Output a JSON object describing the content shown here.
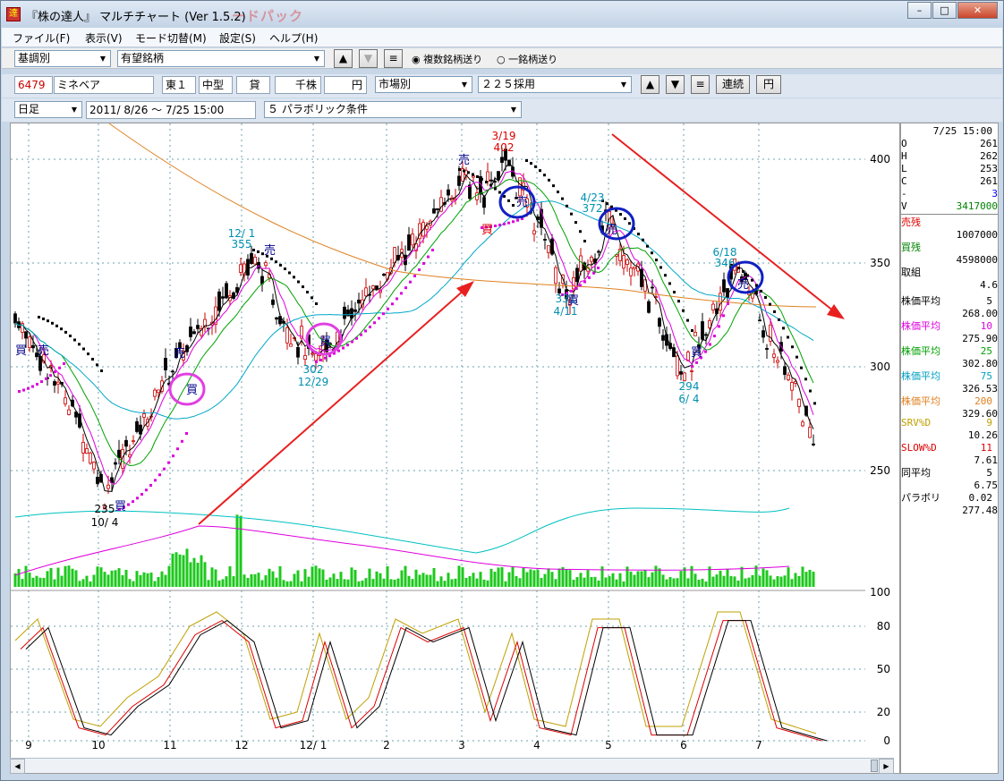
{
  "window": {
    "title": "『株の達人』 マルチチャート (Ver 1.5.2)",
    "watermark": "ードパック",
    "min": "–",
    "max": "□",
    "close": "✕"
  },
  "menu": [
    "ファイル(F)",
    "表示(V)",
    "モード切替(M)",
    "設定(S)",
    "ヘルプ(H)"
  ],
  "toolbar1": {
    "category": "基調別",
    "list": "有望銘柄",
    "up": "▲",
    "down": "▼",
    "eq": "≡",
    "radio1": "複数銘柄送り",
    "radio2": "一銘柄送り"
  },
  "toolbar2": {
    "code": "6479",
    "name": "ミネベア",
    "market": "東１",
    "size": "中型",
    "lend": "貸",
    "unit": "千株",
    "yen_box": "",
    "yen": "円",
    "group": "市場別",
    "index": "２２５採用",
    "up": "▲",
    "down": "▼",
    "eq": "≡",
    "cont": "連続",
    "yen2": "円"
  },
  "toolbar3": {
    "period": "日足",
    "range": "2011/ 8/26 ～  7/25 15:00",
    "condition": "５ パラボリック条件"
  },
  "info": {
    "date": "7/25 15:00",
    "O": "261",
    "H": "262",
    "L": "253",
    "C": "261",
    "chg_label": "-",
    "chg": "3",
    "V": "3417000",
    "sell_label": "売残",
    "sell": "1007000",
    "buy_label": "買残",
    "buy": "4598000",
    "ratio_label": "取組",
    "ratio": "4.6",
    "ma": [
      {
        "label": "株価平均",
        "n": "5",
        "v": "268.00",
        "color": "#000000"
      },
      {
        "label": "株価平均",
        "n": "10",
        "v": "275.90",
        "color": "#dd00dd"
      },
      {
        "label": "株価平均",
        "n": "25",
        "v": "302.80",
        "color": "#00a000"
      },
      {
        "label": "株価平均",
        "n": "75",
        "v": "326.53",
        "color": "#00a0c0"
      },
      {
        "label": "株価平均",
        "n": "200",
        "v": "329.60",
        "color": "#e08020"
      }
    ],
    "srvd_label": "SRV%D",
    "srvd_n": "9",
    "srvd": "10.26",
    "slowd_label": "SLOW%D",
    "slowd_n": "11",
    "slowd": "7.61",
    "avg_label": "同平均",
    "avg_n": "5",
    "avg": "6.75",
    "para_label": "パラボリ",
    "para_n": "0.02",
    "para": "277.48"
  },
  "chart_data": {
    "type": "candlestick",
    "price_ticks": [
      "400",
      "350",
      "300",
      "250"
    ],
    "osc_ticks": [
      "100",
      "80",
      "50",
      "20",
      "0"
    ],
    "months": [
      "9",
      "10",
      "11",
      "12",
      "12/ 1",
      "2",
      "3",
      "4",
      "5",
      "6",
      "7"
    ],
    "annotations": [
      {
        "t": "3/19",
        "c": "#d00"
      },
      {
        "t": "402",
        "c": "#d00"
      },
      {
        "t": "12/ 1",
        "c": "#0090b0"
      },
      {
        "t": "355",
        "c": "#0090b0"
      },
      {
        "t": "4/23",
        "c": "#0090b0"
      },
      {
        "t": "372",
        "c": "#0090b0"
      },
      {
        "t": "6/18",
        "c": "#0090b0"
      },
      {
        "t": "346",
        "c": "#0090b0"
      },
      {
        "t": "331",
        "c": "#0090b0"
      },
      {
        "t": "4/11",
        "c": "#0090b0"
      },
      {
        "t": "302",
        "c": "#0090b0"
      },
      {
        "t": "12/29",
        "c": "#0090b0"
      },
      {
        "t": "294",
        "c": "#0090b0"
      },
      {
        "t": "6/ 4",
        "c": "#0090b0"
      },
      {
        "t": "235",
        "c": "#000"
      },
      {
        "t": "10/ 4",
        "c": "#000"
      }
    ],
    "sell_mark": "売",
    "buy_mark": "買"
  }
}
